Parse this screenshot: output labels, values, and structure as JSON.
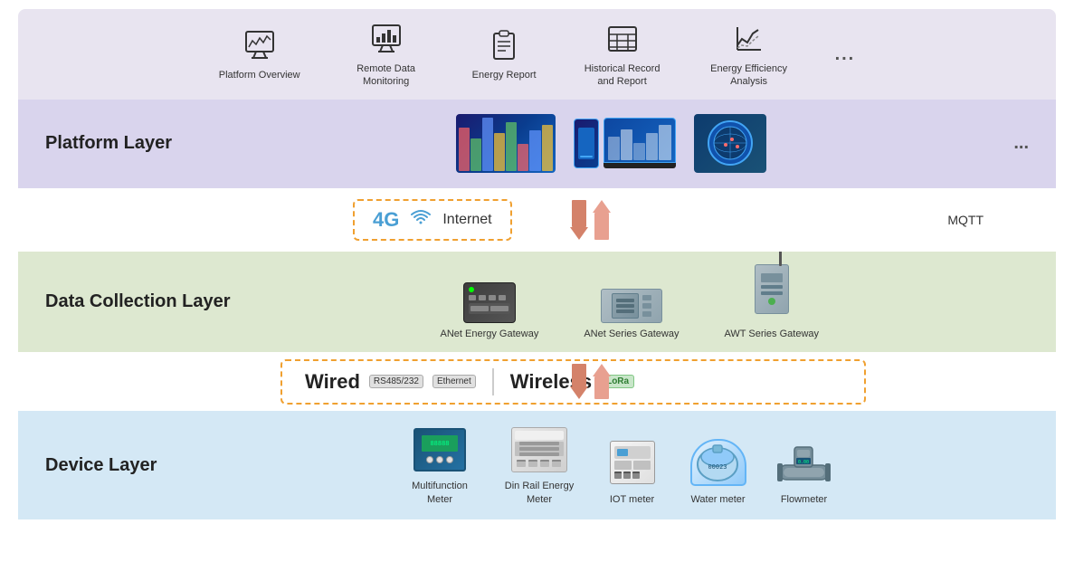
{
  "app_layer": {
    "items": [
      {
        "id": "platform-overview",
        "label": "Platform Overview"
      },
      {
        "id": "remote-data-monitoring",
        "label": "Remote Data Monitoring"
      },
      {
        "id": "energy-report",
        "label": "Energy Report"
      },
      {
        "id": "historical-record",
        "label": "Historical Record and Report"
      },
      {
        "id": "energy-efficiency",
        "label": "Energy Efficiency Analysis"
      }
    ],
    "more": "..."
  },
  "platform_layer": {
    "title": "Platform Layer",
    "more": "..."
  },
  "comm_layer": {
    "signal": "4G",
    "internet": "Internet",
    "protocol": "MQTT"
  },
  "data_collection_layer": {
    "title": "Data Collection Layer",
    "gateways": [
      {
        "id": "anet-energy",
        "label": "ANet Energy Gateway"
      },
      {
        "id": "anet-series",
        "label": "ANet Series Gateway"
      },
      {
        "id": "awt-series",
        "label": "AWT Series Gateway"
      }
    ]
  },
  "wire_layer": {
    "wired_label": "Wired",
    "rs_badge": "RS485/232",
    "ethernet_badge": "Ethernet",
    "wireless_label": "Wireless",
    "lora_badge": "LoRa"
  },
  "device_layer": {
    "title": "Device Layer",
    "devices": [
      {
        "id": "multifunction-meter",
        "label": "Multifunction Meter"
      },
      {
        "id": "din-rail-meter",
        "label": "Din Rail Energy Meter"
      },
      {
        "id": "iot-meter",
        "label": "IOT meter"
      },
      {
        "id": "water-meter",
        "label": "Water meter"
      },
      {
        "id": "flowmeter",
        "label": "Flowmeter"
      }
    ]
  }
}
